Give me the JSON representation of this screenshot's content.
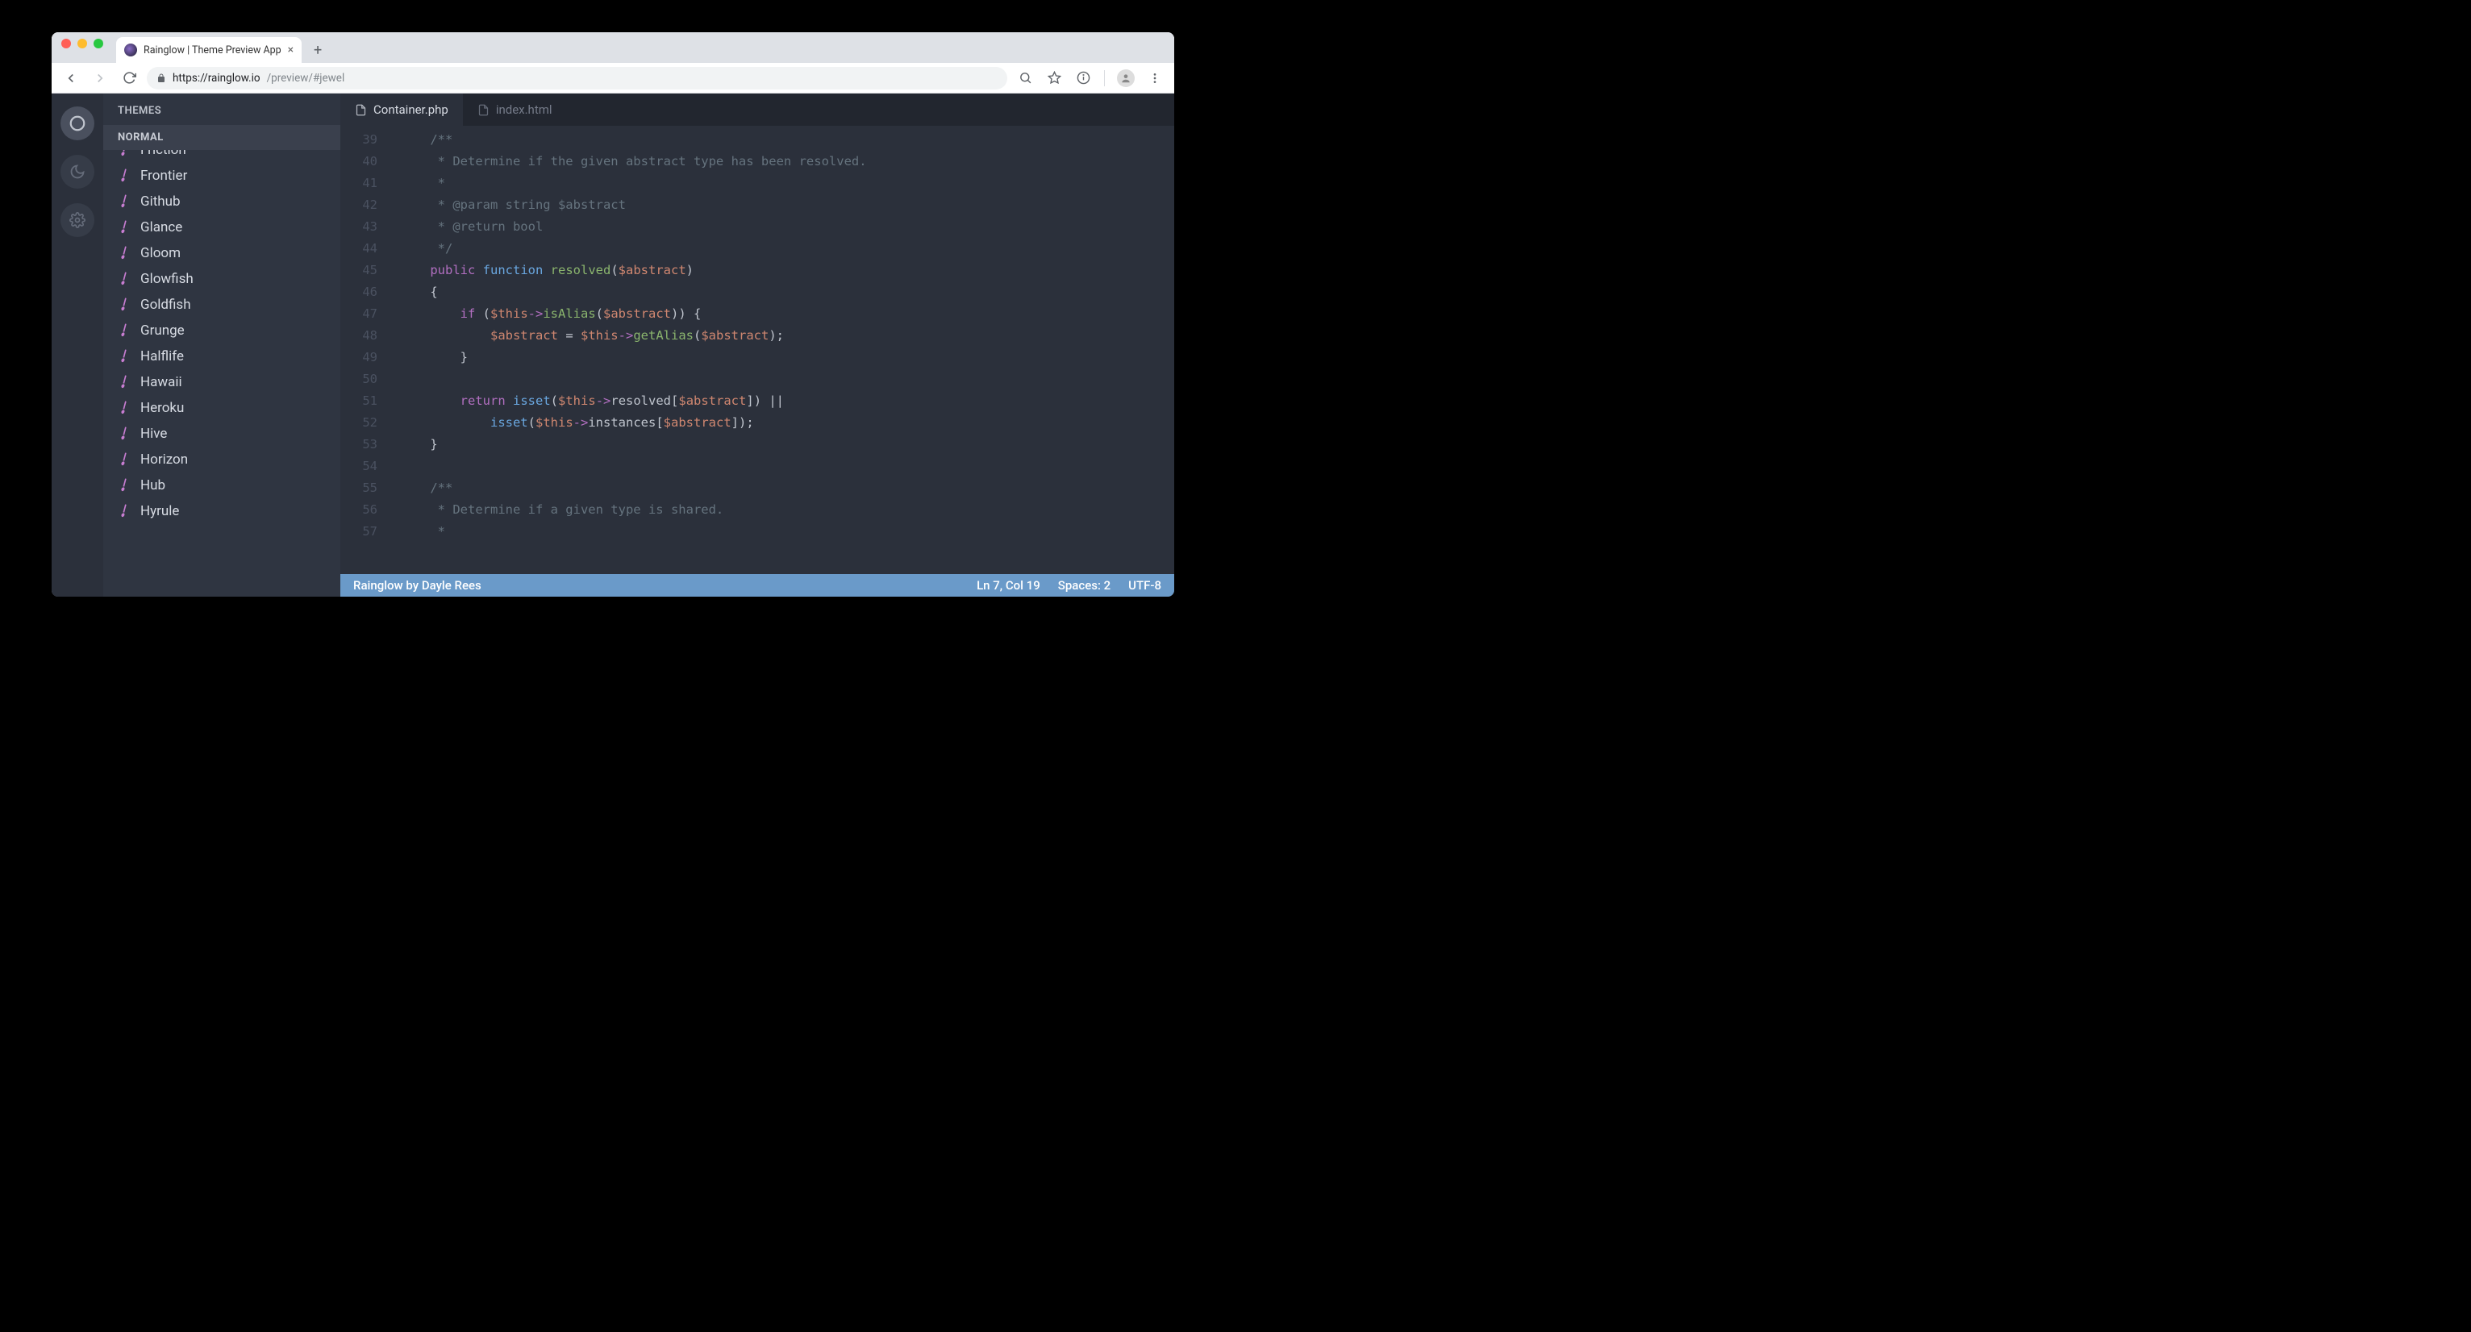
{
  "browser": {
    "tab_title": "Rainglow | Theme Preview App",
    "url_host": "https://rainglow.io",
    "url_path": "/preview/#jewel"
  },
  "sidebar": {
    "title": "THEMES",
    "section": "NORMAL",
    "items": [
      {
        "label": "Friction"
      },
      {
        "label": "Frontier"
      },
      {
        "label": "Github"
      },
      {
        "label": "Glance"
      },
      {
        "label": "Gloom"
      },
      {
        "label": "Glowfish"
      },
      {
        "label": "Goldfish"
      },
      {
        "label": "Grunge"
      },
      {
        "label": "Halflife"
      },
      {
        "label": "Hawaii"
      },
      {
        "label": "Heroku"
      },
      {
        "label": "Hive"
      },
      {
        "label": "Horizon"
      },
      {
        "label": "Hub"
      },
      {
        "label": "Hyrule"
      }
    ]
  },
  "editor": {
    "tabs": [
      {
        "label": "Container.php",
        "active": true
      },
      {
        "label": "index.html",
        "active": false
      }
    ],
    "first_line": 39,
    "lines": [
      [
        {
          "t": "    /**",
          "c": "c-comment"
        }
      ],
      [
        {
          "t": "     * Determine if the given abstract type has been resolved.",
          "c": "c-comment"
        }
      ],
      [
        {
          "t": "     *",
          "c": "c-comment"
        }
      ],
      [
        {
          "t": "     * @param string $abstract",
          "c": "c-comment"
        }
      ],
      [
        {
          "t": "     * @return bool",
          "c": "c-comment"
        }
      ],
      [
        {
          "t": "     */",
          "c": "c-comment"
        }
      ],
      [
        {
          "t": "    "
        },
        {
          "t": "public",
          "c": "c-keyword"
        },
        {
          "t": " "
        },
        {
          "t": "function",
          "c": "c-func"
        },
        {
          "t": " "
        },
        {
          "t": "resolved",
          "c": "c-method"
        },
        {
          "t": "("
        },
        {
          "t": "$abstract",
          "c": "c-var"
        },
        {
          "t": ")"
        }
      ],
      [
        {
          "t": "    {"
        }
      ],
      [
        {
          "t": "        "
        },
        {
          "t": "if",
          "c": "c-keyword"
        },
        {
          "t": " ("
        },
        {
          "t": "$this",
          "c": "c-this"
        },
        {
          "t": "->",
          "c": "c-op"
        },
        {
          "t": "isAlias",
          "c": "c-method"
        },
        {
          "t": "("
        },
        {
          "t": "$abstract",
          "c": "c-var"
        },
        {
          "t": ")) {"
        }
      ],
      [
        {
          "t": "            "
        },
        {
          "t": "$abstract",
          "c": "c-var"
        },
        {
          "t": " = "
        },
        {
          "t": "$this",
          "c": "c-this"
        },
        {
          "t": "->",
          "c": "c-op"
        },
        {
          "t": "getAlias",
          "c": "c-method"
        },
        {
          "t": "("
        },
        {
          "t": "$abstract",
          "c": "c-var"
        },
        {
          "t": ");"
        }
      ],
      [
        {
          "t": "        }"
        }
      ],
      [
        {
          "t": " "
        }
      ],
      [
        {
          "t": "        "
        },
        {
          "t": "return",
          "c": "c-return"
        },
        {
          "t": " "
        },
        {
          "t": "isset",
          "c": "c-func"
        },
        {
          "t": "("
        },
        {
          "t": "$this",
          "c": "c-this"
        },
        {
          "t": "->",
          "c": "c-op"
        },
        {
          "t": "resolved["
        },
        {
          "t": "$abstract",
          "c": "c-var"
        },
        {
          "t": "]) ||"
        }
      ],
      [
        {
          "t": "            "
        },
        {
          "t": "isset",
          "c": "c-func"
        },
        {
          "t": "("
        },
        {
          "t": "$this",
          "c": "c-this"
        },
        {
          "t": "->",
          "c": "c-op"
        },
        {
          "t": "instances["
        },
        {
          "t": "$abstract",
          "c": "c-var"
        },
        {
          "t": "]);"
        }
      ],
      [
        {
          "t": "    }"
        }
      ],
      [
        {
          "t": " "
        }
      ],
      [
        {
          "t": "    /**",
          "c": "c-comment"
        }
      ],
      [
        {
          "t": "     * Determine if a given type is shared.",
          "c": "c-comment"
        }
      ],
      [
        {
          "t": "     *",
          "c": "c-comment"
        }
      ]
    ]
  },
  "status": {
    "left": "Rainglow by Dayle Rees",
    "position": "Ln 7, Col 19",
    "spaces": "Spaces: 2",
    "encoding": "UTF-8"
  }
}
